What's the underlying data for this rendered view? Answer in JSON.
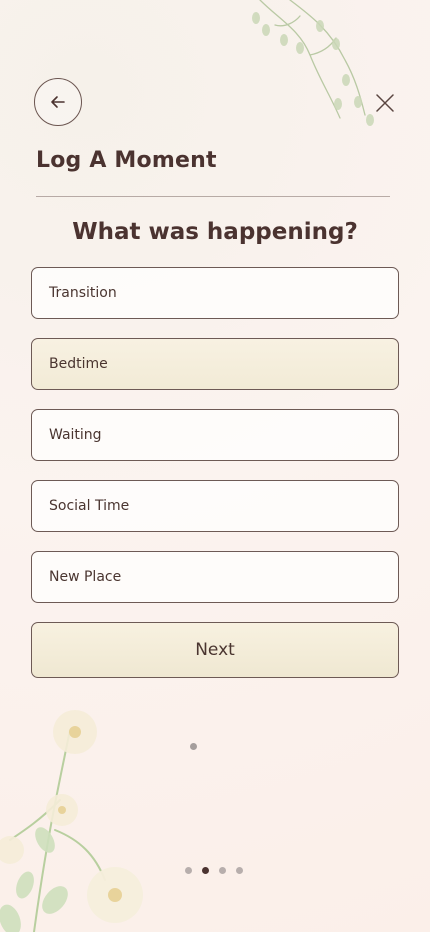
{
  "header": {
    "title": "Log A Moment"
  },
  "question": "What was happening?",
  "options": [
    {
      "label": "Transition",
      "selected": false
    },
    {
      "label": "Bedtime",
      "selected": true
    },
    {
      "label": "Waiting",
      "selected": false
    },
    {
      "label": "Social Time",
      "selected": false
    },
    {
      "label": "New Place",
      "selected": false
    }
  ],
  "next_button": {
    "label": "Next"
  },
  "pagination": {
    "total": 4,
    "current": 2
  },
  "colors": {
    "text": "#4b3330",
    "border": "#6d5a55",
    "selected_fill": "#f2ebd6",
    "background": "#fbf3ef"
  },
  "icons": {
    "back": "arrow-left-icon",
    "close": "close-icon"
  }
}
